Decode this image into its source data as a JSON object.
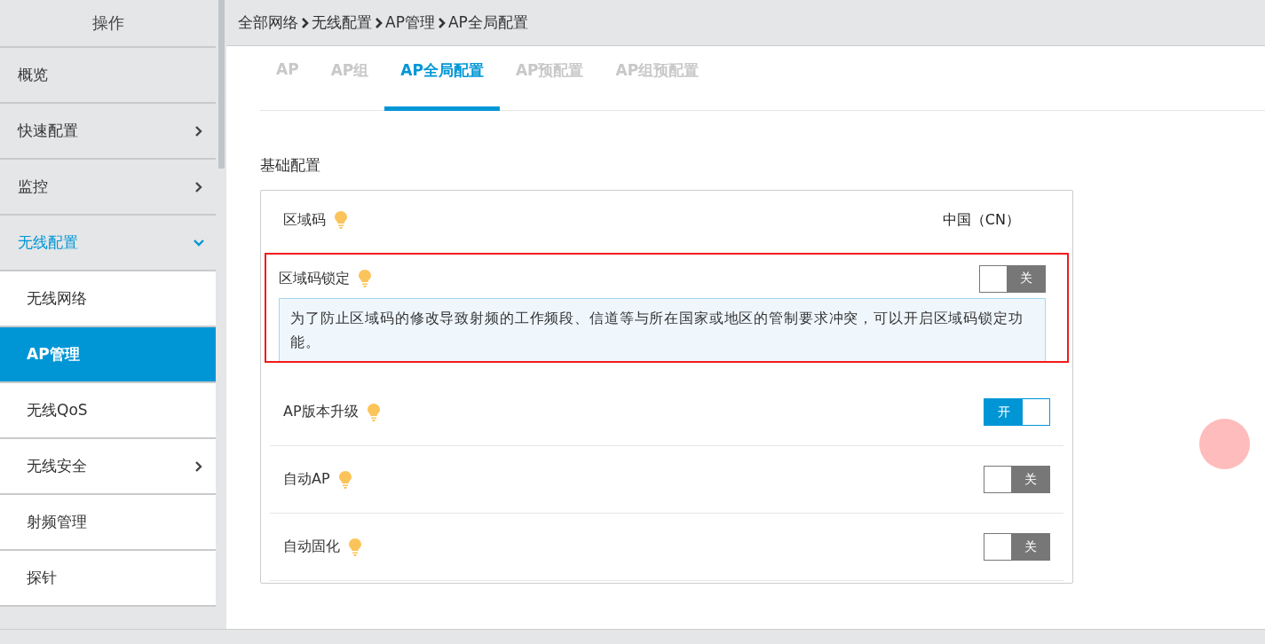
{
  "sidebar": {
    "header": "操作",
    "items": [
      {
        "label": "概览",
        "kind": "link",
        "selected": false
      },
      {
        "label": "快速配置",
        "kind": "group",
        "expanded": false,
        "selected": false
      },
      {
        "label": "监控",
        "kind": "group",
        "expanded": false,
        "selected": false
      },
      {
        "label": "无线配置",
        "kind": "group",
        "expanded": true,
        "selected": false,
        "children": [
          {
            "label": "无线网络",
            "kind": "link",
            "selected": false
          },
          {
            "label": "AP管理",
            "kind": "link",
            "selected": true
          },
          {
            "label": "无线QoS",
            "kind": "link",
            "selected": false
          },
          {
            "label": "无线安全",
            "kind": "group",
            "expanded": false,
            "selected": false
          },
          {
            "label": "射频管理",
            "kind": "link",
            "selected": false
          },
          {
            "label": "探针",
            "kind": "link",
            "selected": false
          }
        ]
      }
    ]
  },
  "breadcrumb": [
    "全部网络",
    "无线配置",
    "AP管理",
    "AP全局配置"
  ],
  "tabs": [
    {
      "label": "AP",
      "selected": false
    },
    {
      "label": "AP组",
      "selected": false
    },
    {
      "label": "AP全局配置",
      "selected": true
    },
    {
      "label": "AP预配置",
      "selected": false
    },
    {
      "label": "AP组预配置",
      "selected": false
    }
  ],
  "section": {
    "title": "基础配置",
    "rows": [
      {
        "label": "区域码",
        "kind": "text",
        "value": "中国（CN）"
      },
      {
        "label": "区域码锁定",
        "kind": "toggle",
        "on": false,
        "state_label": "关",
        "highlighted": true,
        "description": "为了防止区域码的修改导致射频的工作频段、信道等与所在国家或地区的管制要求冲突，可以开启区域码锁定功能。"
      },
      {
        "label": "AP版本升级",
        "kind": "toggle",
        "on": true,
        "state_label": "开"
      },
      {
        "label": "自动AP",
        "kind": "toggle",
        "on": false,
        "state_label": "关"
      },
      {
        "label": "自动固化",
        "kind": "toggle",
        "on": false,
        "state_label": "关"
      }
    ]
  }
}
